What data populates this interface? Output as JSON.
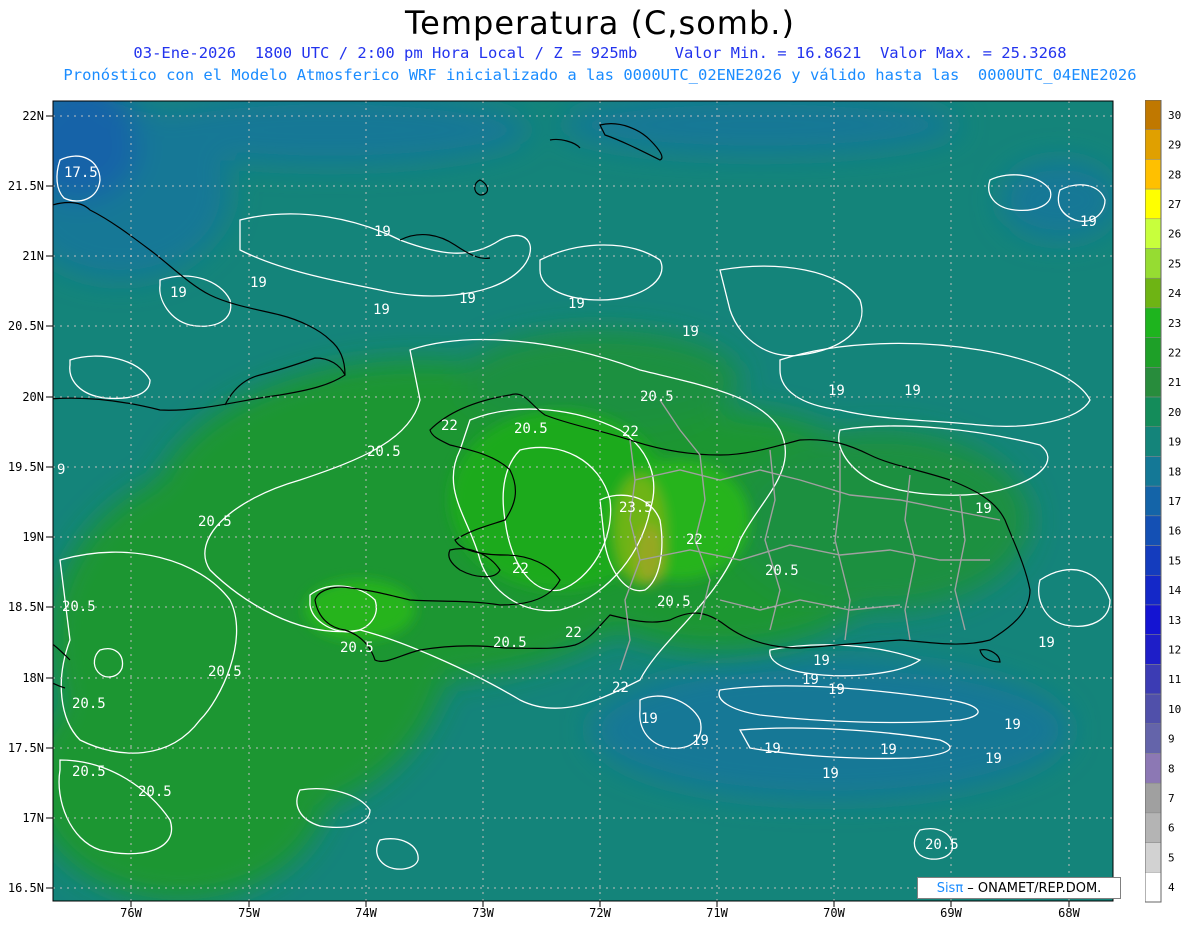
{
  "header": {
    "title": "Temperatura (C,somb.)",
    "line1": "03-Ene-2026  1800 UTC / 2:00 pm Hora Local / Z = 925mb    Valor Min. = 16.8621  Valor Max. = 25.3268",
    "line2": "Pronóstico con el Modelo Atmosferico WRF inicializado a las 0000UTC_02ENE2026 y válido hasta las  0000UTC_04ENE2026"
  },
  "map": {
    "lat_labels": [
      "22N",
      "21.5N",
      "21N",
      "20.5N",
      "20N",
      "19.5N",
      "19N",
      "18.5N",
      "18N",
      "17.5N",
      "17N",
      "16.5N"
    ],
    "lon_labels": [
      "76W",
      "75W",
      "74W",
      "73W",
      "72W",
      "71W",
      "70W",
      "69W",
      "68W"
    ],
    "contour_labels": [
      "17.5",
      "19",
      "19",
      "19",
      "19",
      "19",
      "19",
      "19",
      "19",
      "19",
      "19",
      "19",
      "19",
      "19",
      "19",
      "19",
      "19",
      "19",
      "19",
      "19",
      "19",
      "19",
      "19",
      "20.5",
      "20.5",
      "20.5",
      "20.5",
      "20.5",
      "20.5",
      "20.5",
      "20.5",
      "20.5",
      "20.5",
      "20.5",
      "20.5",
      "20.5",
      "20.5",
      "22",
      "22",
      "22",
      "22",
      "22",
      "22",
      "23.5",
      "9"
    ],
    "ocean_color": "#14847a",
    "land_color": "#1fa046"
  },
  "colorbar": {
    "levels": [
      "30",
      "29",
      "28",
      "27",
      "26",
      "25",
      "24",
      "23",
      "22",
      "21",
      "20",
      "19",
      "18",
      "17",
      "16",
      "15",
      "14",
      "13",
      "12",
      "11",
      "10",
      "9",
      "8",
      "7",
      "6",
      "5",
      "4"
    ],
    "colors": [
      "#c07800",
      "#e0a000",
      "#ffc000",
      "#ffff00",
      "#c8ff3c",
      "#96dc32",
      "#6eb414",
      "#1eb41e",
      "#1ea028",
      "#288c3c",
      "#148c5a",
      "#14847a",
      "#147896",
      "#1464a8",
      "#1450b4",
      "#143cbe",
      "#1428c8",
      "#1414d2",
      "#1e1ec8",
      "#3c3cb4",
      "#5050aa",
      "#6464aa",
      "#8c78b4",
      "#a0a0a0",
      "#b4b4b4",
      "#d2d2d2",
      "#ffffff"
    ]
  },
  "credit": {
    "brand": "Sisπ",
    "text": " – ONAMET/REP.DOM."
  }
}
